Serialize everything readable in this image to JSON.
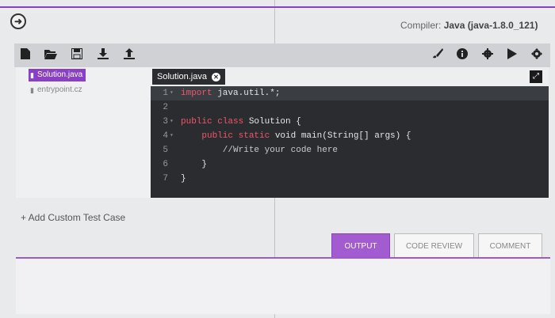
{
  "header": {
    "compiler_label": "Compiler:",
    "compiler_value": "Java (java-1.8.0_121)"
  },
  "toolbar": {
    "left_icons": [
      "file-icon",
      "folder-open-icon",
      "save-icon",
      "download-icon",
      "upload-icon"
    ],
    "right_icons": [
      "brush-icon",
      "info-icon",
      "gear-icon",
      "play-icon",
      "settings-icon"
    ]
  },
  "files": [
    {
      "name": "Solution.java",
      "active": true
    },
    {
      "name": "entrypoint.cz",
      "active": false
    }
  ],
  "editor": {
    "tab_label": "Solution.java",
    "lines": [
      {
        "num": "1",
        "fold": "▾",
        "parts": [
          {
            "text": "import",
            "cls": "kw"
          },
          {
            "text": " java.util.*;",
            "cls": ""
          }
        ]
      },
      {
        "num": "2",
        "fold": "",
        "parts": []
      },
      {
        "num": "3",
        "fold": "▾",
        "parts": [
          {
            "text": "public class",
            "cls": "kw"
          },
          {
            "text": " Solution {",
            "cls": ""
          }
        ]
      },
      {
        "num": "4",
        "fold": "▾",
        "parts": [
          {
            "text": "    public static",
            "cls": "kw"
          },
          {
            "text": " void main(String[] args) {",
            "cls": ""
          }
        ]
      },
      {
        "num": "5",
        "fold": "",
        "parts": [
          {
            "text": "        //Write your code here",
            "cls": "cm"
          }
        ]
      },
      {
        "num": "6",
        "fold": "",
        "parts": [
          {
            "text": "    }",
            "cls": ""
          }
        ]
      },
      {
        "num": "7",
        "fold": "",
        "parts": [
          {
            "text": "}",
            "cls": ""
          }
        ]
      }
    ]
  },
  "add_test_case": "+ Add Custom Test Case",
  "output_tabs": {
    "output": "OUTPUT",
    "code_review": "CODE REVIEW",
    "comment": "COMMENT"
  },
  "colors": {
    "accent": "#8a3fc7",
    "editor_bg": "#2a2c30",
    "keyword": "#f0566d"
  }
}
